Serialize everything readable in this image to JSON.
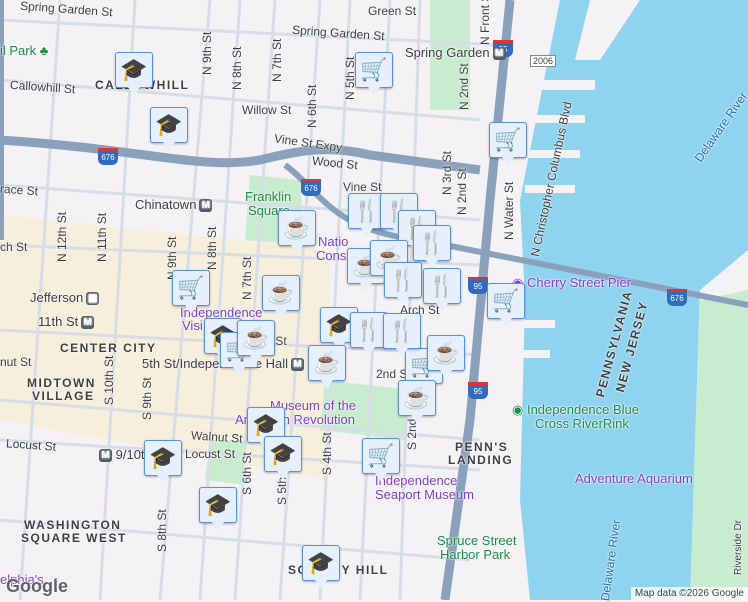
{
  "streets": {
    "spring_garden_w": "Spring Garden St",
    "spring_garden_e": "Spring Garden St",
    "green": "Green St",
    "callowhill": "Callowhill St",
    "willow": "Willow St",
    "vine_expy": "Vine St Expy",
    "wood": "Wood St",
    "vine": "Vine St",
    "race": "race St",
    "arch_w": "ch St",
    "arch_e": "Arch St",
    "walnut_w": "nut St",
    "walnut": "Walnut St",
    "locust_w": "Locust St",
    "locust": "Locust St",
    "market": "et St",
    "n9": "N 9th St",
    "n8": "N 8th St",
    "n7": "N 7th St",
    "n6": "N 6th St",
    "n5": "N 5th St",
    "n12": "N 12th St",
    "n11": "N 11th St",
    "n9b": "N 9th St",
    "n8b": "N 8th St",
    "n7b": "N 7th St",
    "n3": "N 3rd St",
    "n2": "N 2nd St",
    "n2b": "N 2nd St",
    "nwater": "N Water St",
    "nfront": "N Front St",
    "columbus": "N Christopher Columbus Blvd",
    "s10": "S 10th St",
    "s9": "S 9th St",
    "s8": "S 8th St",
    "s6": "S 6th St",
    "s5": "S 5th St",
    "s4": "S 4th St",
    "s2": "S 2nd St",
    "s2nd": "2nd St"
  },
  "districts": {
    "callowhill": "CALLOWHILL",
    "center_city": "CENTER CITY",
    "midtown": "MIDTOWN",
    "village": "VILLAGE",
    "wsw1": "WASHINGTON",
    "wsw2": "SQUARE WEST",
    "society_hill": "SOCIETY HILL",
    "penns1": "PENN'S",
    "penns2": "LANDING",
    "penn": "PENNSYLVANIA",
    "nj": "NEW JERSEY"
  },
  "pois": {
    "park": "il Park",
    "franklin1": "Franklin",
    "franklin2": "Square",
    "national1": "Natio",
    "national2": "Cons",
    "indep1": "Independence",
    "indep2": "Visi",
    "museum1": "Museum of the",
    "museum2": "American Revolution",
    "cherry": "Cherry Street Pier",
    "rink1": "Independence Blue",
    "rink2": "Cross RiverRink",
    "seaport1": "Independence",
    "seaport2": "Seaport Museum",
    "spruce1": "Spruce Street",
    "spruce2": "Harbor Park",
    "aquarium": "Adventure Aquarium",
    "garden": "elphia's",
    "delaware_ne": "Delaware River",
    "delaware_s": "Delaware River",
    "riverside": "Riverside Dr"
  },
  "stations": {
    "spring_garden": "Spring Garden",
    "chinatown": "Chinatown",
    "jefferson": "Jefferson",
    "eleventh": "11th St",
    "fifth": "5th St/Independence Hall",
    "ninth_tenth": "9/10th"
  },
  "highways": {
    "i676a": "676",
    "i676b": "676",
    "i676c": "676",
    "i95a": "95",
    "i95b": "95",
    "i95c": "95",
    "r2006": "2006"
  },
  "markers": {
    "school": "graduation-cap-icon",
    "cart": "shopping-cart-icon",
    "food": "fork-knife-icon",
    "coffee": "coffee-cup-icon"
  },
  "attribution": "Map data ©2026 Google",
  "logo": "Google",
  "colors": {
    "water": "#8fd3ef",
    "marker_bg": "#e6effc",
    "marker_icon": "#0d3d61",
    "highway": "#8aa0bb"
  }
}
